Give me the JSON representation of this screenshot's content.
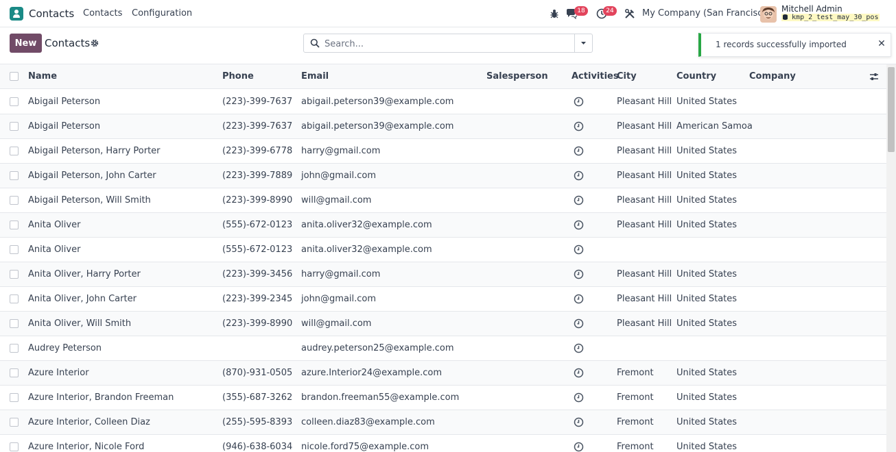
{
  "navbar": {
    "app_name": "Contacts",
    "menu": [
      "Contacts",
      "Configuration"
    ],
    "chat_badge": "18",
    "activity_badge": "24",
    "company": "My Company (San Francisco)",
    "user_name": "Mitchell Admin",
    "database": "kmp_2_test_may_30_pos"
  },
  "control": {
    "new_label": "New",
    "title": "Contacts",
    "search_placeholder": "Search..."
  },
  "toast": {
    "message": "1 records successfully imported",
    "close_glyph": "✕",
    "accent": "#28a745"
  },
  "colors": {
    "brand": "#714b67",
    "app_icon": "#1a8a86",
    "badge": "#e2445c"
  },
  "table": {
    "headers": {
      "name": "Name",
      "phone": "Phone",
      "email": "Email",
      "salesperson": "Salesperson",
      "activities": "Activities",
      "city": "City",
      "country": "Country",
      "company": "Company"
    },
    "rows": [
      {
        "name": "Abigail Peterson",
        "phone": "(223)-399-7637",
        "email": "abigail.peterson39@example.com",
        "city": "Pleasant Hill",
        "country": "United States"
      },
      {
        "name": "Abigail Peterson",
        "phone": "(223)-399-7637",
        "email": "abigail.peterson39@example.com",
        "city": "Pleasant Hill",
        "country": "American Samoa"
      },
      {
        "name": "Abigail Peterson, Harry Porter",
        "phone": "(223)-399-6778",
        "email": "harry@gmail.com",
        "city": "Pleasant Hill",
        "country": "United States"
      },
      {
        "name": "Abigail Peterson, John Carter",
        "phone": "(223)-399-7889",
        "email": "john@gmail.com",
        "city": "Pleasant Hill",
        "country": "United States"
      },
      {
        "name": "Abigail Peterson, Will Smith",
        "phone": "(223)-399-8990",
        "email": "will@gmail.com",
        "city": "Pleasant Hill",
        "country": "United States"
      },
      {
        "name": "Anita Oliver",
        "phone": "(555)-672-0123",
        "email": "anita.oliver32@example.com",
        "city": "Pleasant Hill",
        "country": "United States"
      },
      {
        "name": "Anita Oliver",
        "phone": "(555)-672-0123",
        "email": "anita.oliver32@example.com",
        "city": "",
        "country": ""
      },
      {
        "name": "Anita Oliver, Harry Porter",
        "phone": "(223)-399-3456",
        "email": "harry@gmail.com",
        "city": "Pleasant Hill",
        "country": "United States"
      },
      {
        "name": "Anita Oliver, John Carter",
        "phone": "(223)-399-2345",
        "email": "john@gmail.com",
        "city": "Pleasant Hill",
        "country": "United States"
      },
      {
        "name": "Anita Oliver, Will Smith",
        "phone": "(223)-399-8990",
        "email": "will@gmail.com",
        "city": "Pleasant Hill",
        "country": "United States"
      },
      {
        "name": "Audrey Peterson",
        "phone": "",
        "email": "audrey.peterson25@example.com",
        "city": "",
        "country": ""
      },
      {
        "name": "Azure Interior",
        "phone": "(870)-931-0505",
        "email": "azure.Interior24@example.com",
        "city": "Fremont",
        "country": "United States"
      },
      {
        "name": "Azure Interior, Brandon Freeman",
        "phone": "(355)-687-3262",
        "email": "brandon.freeman55@example.com",
        "city": "Fremont",
        "country": "United States"
      },
      {
        "name": "Azure Interior, Colleen Diaz",
        "phone": "(255)-595-8393",
        "email": "colleen.diaz83@example.com",
        "city": "Fremont",
        "country": "United States"
      },
      {
        "name": "Azure Interior, Nicole Ford",
        "phone": "(946)-638-6034",
        "email": "nicole.ford75@example.com",
        "city": "Fremont",
        "country": "United States"
      }
    ]
  }
}
